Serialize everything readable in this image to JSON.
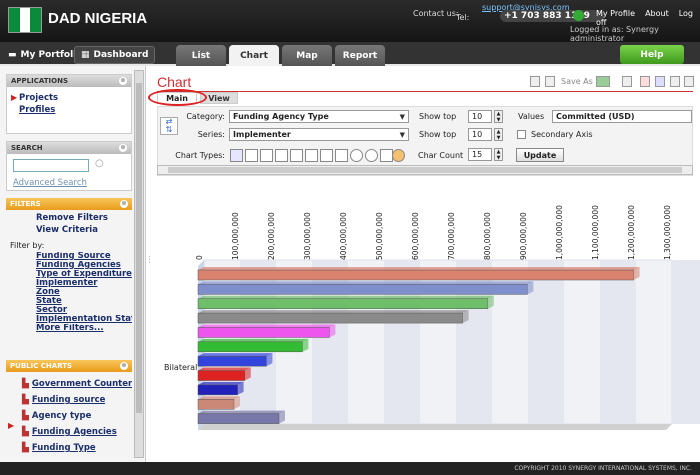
{
  "header": {
    "app_name": "DAD NIGERIA",
    "contact_label": "Contact us:",
    "email": "support@synisys.com",
    "tel_label": "Tel:",
    "phone": "+1 703 883 1119",
    "links": [
      "My Profile",
      "About",
      "Log off"
    ],
    "logged_in": "Logged in as: Synergy administrator"
  },
  "nav": {
    "my_portfolio": "My Portfolio",
    "dashboard": "Dashboard",
    "tabs": [
      "List",
      "Chart",
      "Map",
      "Report"
    ],
    "active_tab": "Chart",
    "help": "Help"
  },
  "sidebar": {
    "applications": {
      "title": "APPLICATIONS",
      "items": [
        "Projects",
        "Profiles"
      ]
    },
    "search": {
      "title": "SEARCH",
      "advanced": "Advanced Search"
    },
    "filters": {
      "title": "FILTERS",
      "actions": [
        "Remove Filters",
        "View Criteria"
      ],
      "filter_by": "Filter by:",
      "items": [
        "Funding Source",
        "Funding Agencies",
        "Type of Expenditure",
        "Implementer",
        "Zone",
        "State",
        "Sector",
        "Implementation Status",
        "More Filters..."
      ]
    },
    "public_charts": {
      "title": "PUBLIC CHARTS",
      "items": [
        "Government Counterpart",
        "Funding source",
        "Agency type",
        "Funding Agencies",
        "Funding Type"
      ]
    }
  },
  "chart_page": {
    "title": "Chart",
    "save_as": "Save As",
    "subtabs": [
      "Main",
      "View"
    ],
    "category_label": "Category:",
    "category_value": "Funding Agency Type",
    "series_label": "Series:",
    "series_value": "Implementer",
    "chart_types_label": "Chart Types:",
    "show_top_label": "Show top",
    "show_top_1": "10",
    "show_top_2": "10",
    "values_label": "Values",
    "values_value": "Committed (USD)",
    "secondary_axis": "Secondary Axis",
    "char_count_label": "Char Count",
    "char_count": "15",
    "update": "Update"
  },
  "chart_data": {
    "type": "bar",
    "orientation": "horizontal",
    "categories": [
      "Bilateral"
    ],
    "x_ticks": [
      "0",
      "100,000,000",
      "200,000,000",
      "300,000,000",
      "400,000,000",
      "500,000,000",
      "600,000,000",
      "700,000,000",
      "800,000,000",
      "900,000,000",
      "1,000,000,000",
      "1,100,000,000",
      "1,200,000,000",
      "1,300,000,000"
    ],
    "xlim": [
      0,
      1300000000
    ],
    "series": [
      {
        "values": [
          1210000000
        ],
        "color": "#d9826e"
      },
      {
        "values": [
          915000000
        ],
        "color": "#7f8fcc"
      },
      {
        "values": [
          805000000
        ],
        "color": "#6fbf6a"
      },
      {
        "values": [
          735000000
        ],
        "color": "#8a8a8a"
      },
      {
        "values": [
          365000000
        ],
        "color": "#ee55ee"
      },
      {
        "values": [
          290000000
        ],
        "color": "#33bb33"
      },
      {
        "values": [
          190000000
        ],
        "color": "#3344dd"
      },
      {
        "values": [
          130000000
        ],
        "color": "#dd2222"
      },
      {
        "values": [
          110000000
        ],
        "color": "#2222bb"
      },
      {
        "values": [
          100000000
        ],
        "color": "#cc8877"
      },
      {
        "values": [
          225000000
        ],
        "color": "#7777aa"
      }
    ],
    "grid": true,
    "view": "3d"
  },
  "footer": {
    "copyright": "COPYRIGHT 2010 SYNERGY INTERNATIONAL SYSTEMS, INC."
  }
}
